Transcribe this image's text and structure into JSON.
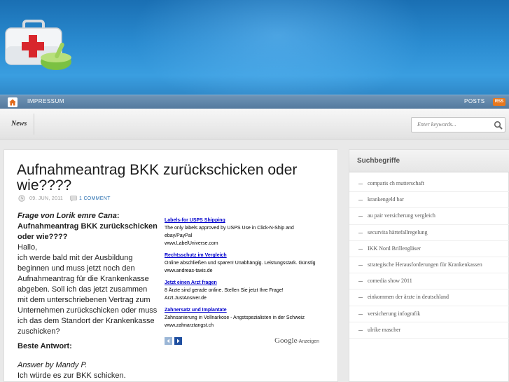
{
  "nav": {
    "impressum": "IMPRESSUM",
    "posts": "POSTS",
    "rss": "RSS"
  },
  "subbar": {
    "news": "News",
    "search_placeholder": "Enter keywords..."
  },
  "post": {
    "title": "Aufnahmeantrag BKK zurückschicken oder wie????",
    "date": "09. JUN, 2011",
    "comments": "1 COMMENT",
    "question_from": "Frage von Lorik emre Cana",
    "question_colon": ":",
    "question_title": "Aufnahmeantrag BKK zurückschicken oder wie????",
    "greeting": "Hallo,",
    "question_text": "ich werde bald mit der Ausbildung beginnen und muss jetzt noch den Aufnahmeantrag für die Krankenkasse abgeben. Soll ich das jetzt zusammen mit dem unterschriebenen Vertrag zum Unternehmen zurückschicken oder muss ich das dem Standort der Krankenkasse zuschicken?",
    "best_answer": "Beste Antwort:",
    "answer_by": "Answer by Mandy P.",
    "answer_text": "Ich würde es zur BKK schicken."
  },
  "ads": [
    {
      "title": "Labels-for USPS Shipping",
      "text": "The only labels approved by USPS Use in Click-N-Ship and ebay/PayPal",
      "url": "www.LabelUniverse.com"
    },
    {
      "title": "Rechtsschutz im Vergleich",
      "text": "Online abschließen und sparen! Unabhängig. Leistungsstark. Günstig",
      "url": "www.andreas-taxis.de"
    },
    {
      "title": "Jetzt einen Arzt fragen",
      "text": "8 Ärzte sind gerade online. Stellen Sie jetzt Ihre Frage!",
      "url": "Arzt.JustAnswer.de"
    },
    {
      "title": "Zahnersatz und Implantate",
      "text": "Zahnsanierung in Vollnarkose - Angstspezialisten in der Schweiz",
      "url": "www.zahnarztangst.ch"
    }
  ],
  "ads_footer": {
    "google": "Google",
    "anzeigen": "-Anzeigen"
  },
  "sidebar": {
    "title": "Suchbegriffe",
    "items": [
      "comparis ch mutterschaft",
      "krankengeld bar",
      "au pair versicherung vergleich",
      "securvita härtefallregelung",
      "IKK Nord Brillengläser",
      "strategische Herausforderungen für Krankenkassen",
      "comedia show 2011",
      "einkommen der ärzte in deutschland",
      "versicherung infografik",
      "ulrike mascher"
    ]
  },
  "colors": {
    "header_blue": "#2a8bd0",
    "nav_blue": "#547a9e",
    "link_blue": "#0000cc",
    "rss_orange": "#e8781e"
  },
  "icons": {
    "logo": "first-aid-kit-icon",
    "home": "home-icon",
    "search": "magnifier-icon",
    "date": "clock-icon",
    "comments": "speech-bubble-icon"
  }
}
